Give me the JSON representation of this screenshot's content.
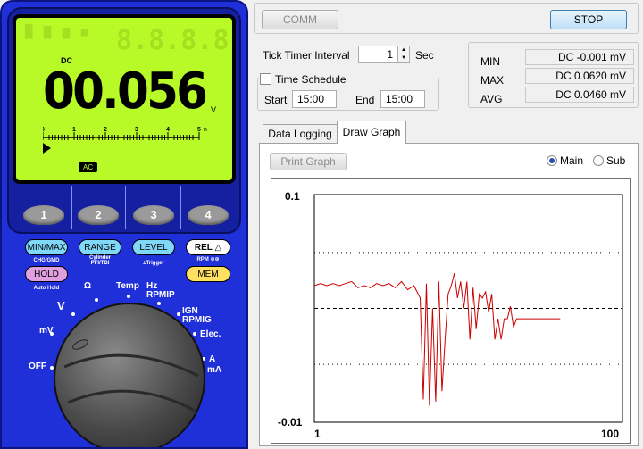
{
  "meter": {
    "lcd": {
      "mode": "DC",
      "value": "00.056",
      "ghost_digits": "8.8.8.8",
      "unit": "V",
      "scale_ticks": [
        "0",
        "1",
        "2",
        "3",
        "4",
        "5"
      ],
      "scale_unit": "n",
      "ac_label": "AC"
    },
    "soft_buttons": [
      "1",
      "2",
      "3",
      "4"
    ],
    "function_buttons": [
      {
        "label": "MIN/MAX",
        "sub": "CHG/GMD",
        "color": "#80d8f8"
      },
      {
        "label": "RANGE",
        "sub": "Cylinder\nPFI/TBI",
        "color": "#80d8f8"
      },
      {
        "label": "LEVEL",
        "sub": "±Trigger",
        "color": "#80d8f8"
      },
      {
        "label": "REL △",
        "sub": "RPM ⊛⊛",
        "color": "#ffffff"
      },
      {
        "label": "HOLD",
        "sub": "Auto Hold",
        "color": "#e0a0e0"
      },
      {
        "label": "MEM",
        "sub": "",
        "color": "#ffe060"
      }
    ],
    "dial_labels": {
      "off": "OFF",
      "mv": "mV",
      "v": "V",
      "ohm": "Ω",
      "temp": "Temp",
      "hz": "Hz",
      "rpmip": "RPMIP",
      "ign": "IGN",
      "rpmig": "RPMIG",
      "elec": "Elec.",
      "a": "A",
      "ma": "mA"
    }
  },
  "toolbar": {
    "comm_label": "COMM",
    "stop_label": "STOP"
  },
  "settings": {
    "tick_timer_label": "Tick Timer Interval",
    "tick_timer_value": "1",
    "tick_timer_unit": "Sec",
    "schedule_label": "Time Schedule",
    "schedule_checked": false,
    "start_label": "Start",
    "start_value": "15:00",
    "end_label": "End",
    "end_value": "15:00"
  },
  "stats": {
    "min_label": "MIN",
    "min_value": "DC  -0.001 mV",
    "max_label": "MAX",
    "max_value": "DC  0.0620 mV",
    "avg_label": "AVG",
    "avg_value": "DC  0.0460 mV"
  },
  "tabs": {
    "data_logging": "Data Logging",
    "draw_graph": "Draw Graph",
    "active": "Draw Graph"
  },
  "graph_panel": {
    "print_label": "Print Graph",
    "main_label": "Main",
    "sub_label": "Sub",
    "selected": "Main"
  },
  "chart_data": {
    "type": "line",
    "y_max_label": "0.1",
    "y_min_label": "-0.01",
    "x_min_label": "1",
    "x_max_label": "100",
    "ylim": [
      -0.01,
      0.1
    ],
    "xlim": [
      1,
      100
    ],
    "color": "#cc0000",
    "gridlines_y": [
      0.072,
      0.045,
      0.018
    ],
    "series": [
      {
        "x": [
          1,
          3,
          5,
          7,
          9,
          11,
          13,
          15,
          17,
          19,
          21,
          23,
          25,
          27,
          29,
          31,
          33,
          35,
          36,
          37,
          38,
          39,
          40,
          41,
          42,
          43,
          44,
          45,
          46,
          47,
          48,
          49,
          50,
          51,
          52,
          53,
          54,
          55,
          56,
          57,
          58,
          59,
          60,
          61,
          62,
          63,
          64,
          65,
          66,
          67,
          68,
          69,
          70,
          71,
          72,
          73,
          74,
          75,
          76,
          77,
          78,
          79,
          80
        ],
        "y": [
          0.056,
          0.057,
          0.056,
          0.057,
          0.056,
          0.057,
          0.058,
          0.055,
          0.056,
          0.055,
          0.057,
          0.056,
          0.057,
          0.055,
          0.058,
          0.054,
          0.056,
          0.05,
          0.001,
          0.057,
          -0.002,
          0.045,
          0.0,
          0.058,
          0.005,
          0.03,
          0.052,
          0.056,
          0.062,
          0.05,
          0.058,
          0.045,
          0.058,
          0.03,
          0.055,
          0.035,
          0.052,
          0.05,
          0.053,
          0.043,
          0.052,
          0.03,
          0.04,
          0.03,
          0.04,
          0.04,
          0.046,
          0.036,
          0.04,
          0.04,
          0.04,
          0.04,
          0.04,
          0.04,
          0.04,
          0.04,
          0.04,
          0.04,
          0.04,
          0.04,
          0.04,
          0.04,
          0.04
        ]
      }
    ]
  }
}
